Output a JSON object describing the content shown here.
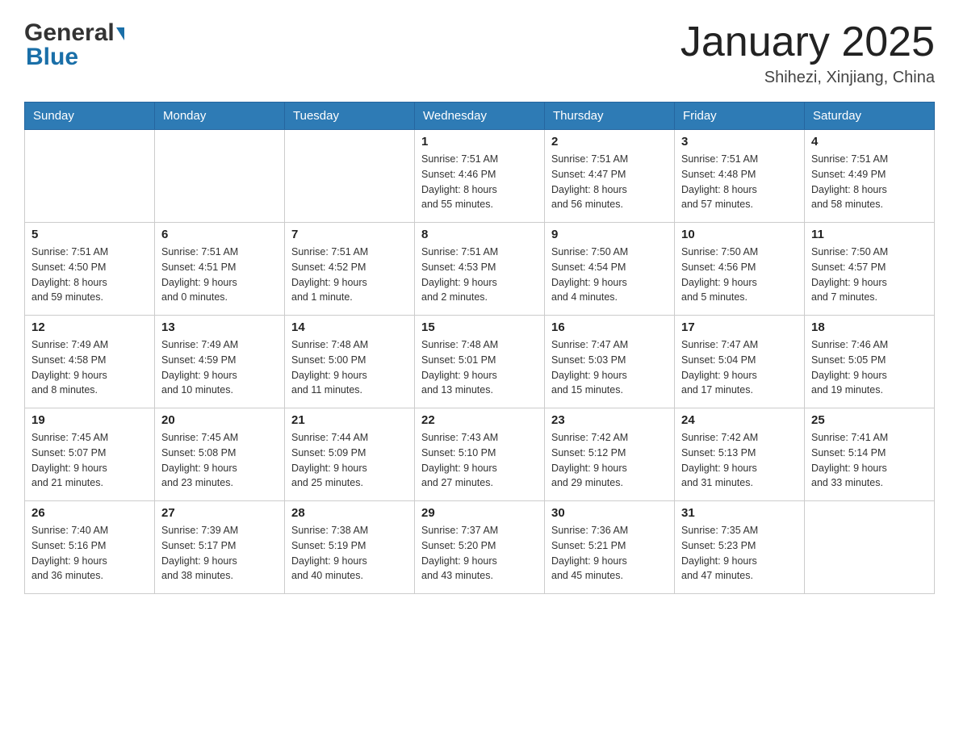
{
  "header": {
    "logo_general": "General",
    "logo_blue": "Blue",
    "title": "January 2025",
    "location": "Shihezi, Xinjiang, China"
  },
  "days_of_week": [
    "Sunday",
    "Monday",
    "Tuesday",
    "Wednesday",
    "Thursday",
    "Friday",
    "Saturday"
  ],
  "weeks": [
    [
      {
        "day": "",
        "info": ""
      },
      {
        "day": "",
        "info": ""
      },
      {
        "day": "",
        "info": ""
      },
      {
        "day": "1",
        "info": "Sunrise: 7:51 AM\nSunset: 4:46 PM\nDaylight: 8 hours\nand 55 minutes."
      },
      {
        "day": "2",
        "info": "Sunrise: 7:51 AM\nSunset: 4:47 PM\nDaylight: 8 hours\nand 56 minutes."
      },
      {
        "day": "3",
        "info": "Sunrise: 7:51 AM\nSunset: 4:48 PM\nDaylight: 8 hours\nand 57 minutes."
      },
      {
        "day": "4",
        "info": "Sunrise: 7:51 AM\nSunset: 4:49 PM\nDaylight: 8 hours\nand 58 minutes."
      }
    ],
    [
      {
        "day": "5",
        "info": "Sunrise: 7:51 AM\nSunset: 4:50 PM\nDaylight: 8 hours\nand 59 minutes."
      },
      {
        "day": "6",
        "info": "Sunrise: 7:51 AM\nSunset: 4:51 PM\nDaylight: 9 hours\nand 0 minutes."
      },
      {
        "day": "7",
        "info": "Sunrise: 7:51 AM\nSunset: 4:52 PM\nDaylight: 9 hours\nand 1 minute."
      },
      {
        "day": "8",
        "info": "Sunrise: 7:51 AM\nSunset: 4:53 PM\nDaylight: 9 hours\nand 2 minutes."
      },
      {
        "day": "9",
        "info": "Sunrise: 7:50 AM\nSunset: 4:54 PM\nDaylight: 9 hours\nand 4 minutes."
      },
      {
        "day": "10",
        "info": "Sunrise: 7:50 AM\nSunset: 4:56 PM\nDaylight: 9 hours\nand 5 minutes."
      },
      {
        "day": "11",
        "info": "Sunrise: 7:50 AM\nSunset: 4:57 PM\nDaylight: 9 hours\nand 7 minutes."
      }
    ],
    [
      {
        "day": "12",
        "info": "Sunrise: 7:49 AM\nSunset: 4:58 PM\nDaylight: 9 hours\nand 8 minutes."
      },
      {
        "day": "13",
        "info": "Sunrise: 7:49 AM\nSunset: 4:59 PM\nDaylight: 9 hours\nand 10 minutes."
      },
      {
        "day": "14",
        "info": "Sunrise: 7:48 AM\nSunset: 5:00 PM\nDaylight: 9 hours\nand 11 minutes."
      },
      {
        "day": "15",
        "info": "Sunrise: 7:48 AM\nSunset: 5:01 PM\nDaylight: 9 hours\nand 13 minutes."
      },
      {
        "day": "16",
        "info": "Sunrise: 7:47 AM\nSunset: 5:03 PM\nDaylight: 9 hours\nand 15 minutes."
      },
      {
        "day": "17",
        "info": "Sunrise: 7:47 AM\nSunset: 5:04 PM\nDaylight: 9 hours\nand 17 minutes."
      },
      {
        "day": "18",
        "info": "Sunrise: 7:46 AM\nSunset: 5:05 PM\nDaylight: 9 hours\nand 19 minutes."
      }
    ],
    [
      {
        "day": "19",
        "info": "Sunrise: 7:45 AM\nSunset: 5:07 PM\nDaylight: 9 hours\nand 21 minutes."
      },
      {
        "day": "20",
        "info": "Sunrise: 7:45 AM\nSunset: 5:08 PM\nDaylight: 9 hours\nand 23 minutes."
      },
      {
        "day": "21",
        "info": "Sunrise: 7:44 AM\nSunset: 5:09 PM\nDaylight: 9 hours\nand 25 minutes."
      },
      {
        "day": "22",
        "info": "Sunrise: 7:43 AM\nSunset: 5:10 PM\nDaylight: 9 hours\nand 27 minutes."
      },
      {
        "day": "23",
        "info": "Sunrise: 7:42 AM\nSunset: 5:12 PM\nDaylight: 9 hours\nand 29 minutes."
      },
      {
        "day": "24",
        "info": "Sunrise: 7:42 AM\nSunset: 5:13 PM\nDaylight: 9 hours\nand 31 minutes."
      },
      {
        "day": "25",
        "info": "Sunrise: 7:41 AM\nSunset: 5:14 PM\nDaylight: 9 hours\nand 33 minutes."
      }
    ],
    [
      {
        "day": "26",
        "info": "Sunrise: 7:40 AM\nSunset: 5:16 PM\nDaylight: 9 hours\nand 36 minutes."
      },
      {
        "day": "27",
        "info": "Sunrise: 7:39 AM\nSunset: 5:17 PM\nDaylight: 9 hours\nand 38 minutes."
      },
      {
        "day": "28",
        "info": "Sunrise: 7:38 AM\nSunset: 5:19 PM\nDaylight: 9 hours\nand 40 minutes."
      },
      {
        "day": "29",
        "info": "Sunrise: 7:37 AM\nSunset: 5:20 PM\nDaylight: 9 hours\nand 43 minutes."
      },
      {
        "day": "30",
        "info": "Sunrise: 7:36 AM\nSunset: 5:21 PM\nDaylight: 9 hours\nand 45 minutes."
      },
      {
        "day": "31",
        "info": "Sunrise: 7:35 AM\nSunset: 5:23 PM\nDaylight: 9 hours\nand 47 minutes."
      },
      {
        "day": "",
        "info": ""
      }
    ]
  ]
}
